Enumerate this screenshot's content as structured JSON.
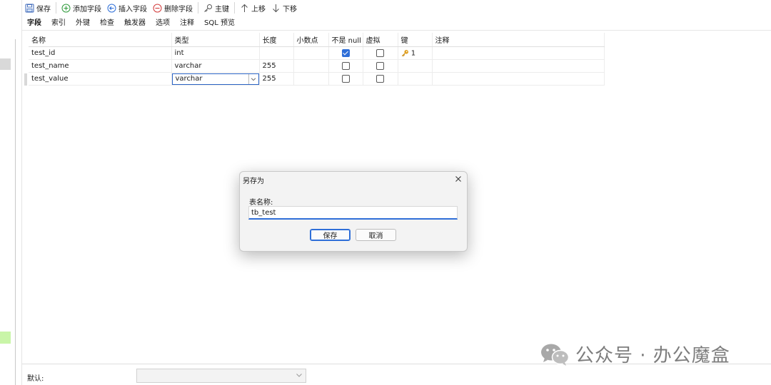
{
  "toolbar": {
    "save": "保存",
    "add_field": "添加字段",
    "insert_field": "插入字段",
    "delete_field": "删除字段",
    "primary_key": "主键",
    "move_up": "上移",
    "move_down": "下移"
  },
  "tabs": [
    "字段",
    "索引",
    "外键",
    "检查",
    "触发器",
    "选项",
    "注释",
    "SQL 预览"
  ],
  "active_tab": "字段",
  "grid": {
    "columns": [
      "名称",
      "类型",
      "长度",
      "小数点",
      "不是 null",
      "虚拟",
      "键",
      "注释"
    ],
    "rows": [
      {
        "name": "test_id",
        "type": "int",
        "length": "",
        "decimals": "",
        "not_null": true,
        "virtual": false,
        "key": "1",
        "comment": ""
      },
      {
        "name": "test_name",
        "type": "varchar",
        "length": "255",
        "decimals": "",
        "not_null": false,
        "virtual": false,
        "key": "",
        "comment": ""
      },
      {
        "name": "test_value",
        "type": "varchar",
        "length": "255",
        "decimals": "",
        "not_null": false,
        "virtual": false,
        "key": "",
        "comment": ""
      }
    ]
  },
  "bottom": {
    "default_label": "默认:",
    "default_value": ""
  },
  "dialog": {
    "title": "另存为",
    "label": "表名称:",
    "input_value": "tb_test",
    "ok": "保存",
    "cancel": "取消"
  },
  "watermark": {
    "text": "公众号 · 办公魔盒"
  },
  "colors": {
    "accent": "#2f6fd8",
    "add": "#2e9a3a",
    "delete": "#d23a3a",
    "key": "#e0a020"
  }
}
